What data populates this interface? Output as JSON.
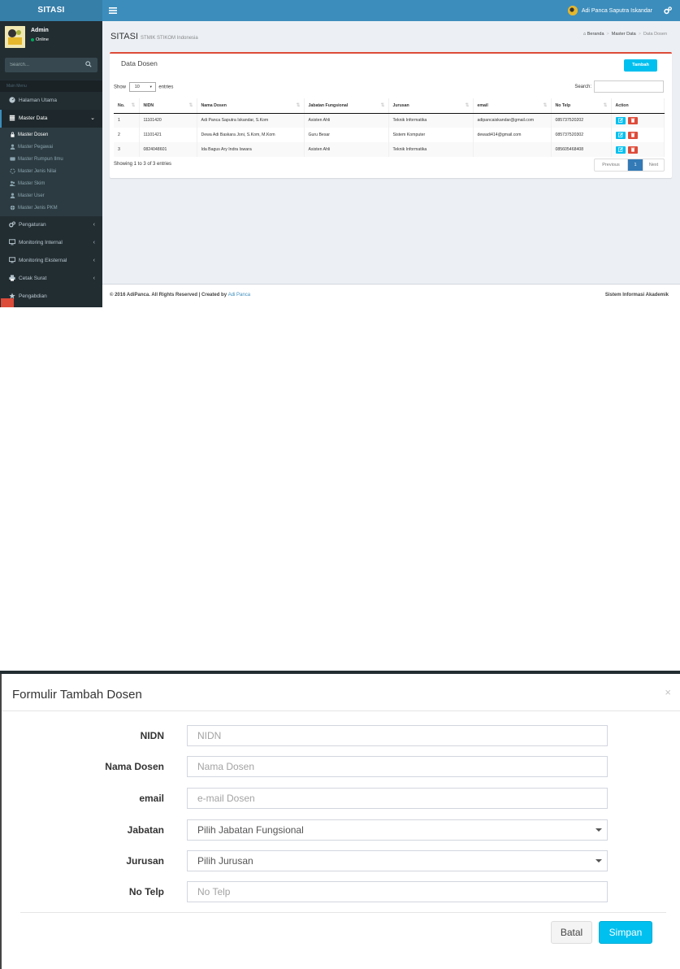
{
  "app": {
    "logo": "SITASI",
    "user": {
      "name": "Admin",
      "status": "Online"
    },
    "search_placeholder": "Search...",
    "menu_header": "Main Menu",
    "nav": {
      "home": "Halaman Utama",
      "master": "Master Data",
      "sub": [
        "Master Dosen",
        "Master Pegawai",
        "Master Rumpun Ilmu",
        "Master Jenis Nilai",
        "Master Skim",
        "Master User",
        "Master Jenis PKM"
      ],
      "pengaturan": "Pengaturan",
      "mon_int": "Monitoring Internal",
      "mon_ext": "Monitoring Eksternal",
      "cetak": "Cetak Surat",
      "pengabdian": "Pengabdian"
    },
    "topbar_user": "Adi Panca Saputra Iskandar",
    "page_title": "SITASI",
    "page_subtitle": "STMIK STIKOM Indonesia",
    "breadcrumb": [
      "Beranda",
      "Master Data",
      "Data Dosen"
    ],
    "box_title": "Data Dosen",
    "add_button": "Tambah",
    "show": {
      "pre": "Show",
      "value": "10",
      "post": "entries"
    },
    "search_label": "Search:",
    "table": {
      "headers": [
        "No.",
        "NIDN",
        "Nama Dosen",
        "Jabatan Fungsional",
        "Jurusan",
        "email",
        "No Telp",
        "Action"
      ],
      "rows": [
        [
          "1",
          "11101420",
          "Adi Panca Saputra Iskandar, S.Kom",
          "Asisten Ahli",
          "Teknik Informatika",
          "adipancaiskandar@gmail.com",
          "085737520202"
        ],
        [
          "2",
          "11101421",
          "Dewa Adi Baskara Joni, S.Kom, M.Kom",
          "Guru Besar",
          "Sistem Komputer",
          "dewadi414@gmail.com",
          "085737520302"
        ],
        [
          "3",
          "0824048601",
          "Ida Bagus Ary Indra Iswara",
          "Asisten Ahli",
          "Teknik Informatika",
          "",
          "085605468408"
        ]
      ]
    },
    "info": "Showing 1 to 3 of 3 entries",
    "pager": {
      "prev": "Previous",
      "page": "1",
      "next": "Next"
    },
    "footer": {
      "left": "© 2016 AdiPanca. All Rights Reserved | Created by",
      "link": "Adi Panca",
      "right": "Sistem Informasi Akademik"
    }
  },
  "modal": {
    "title": "Formulir Tambah Dosen",
    "close": "×",
    "fields": [
      {
        "label": "NIDN",
        "placeholder": "NIDN"
      },
      {
        "label": "Nama Dosen",
        "placeholder": "Nama Dosen"
      },
      {
        "label": "email",
        "placeholder": "e-mail Dosen"
      },
      {
        "label": "Jabatan",
        "value": "Pilih Jabatan Fungsional"
      },
      {
        "label": "Jurusan",
        "value": "Pilih Jurusan"
      },
      {
        "label": "No Telp",
        "placeholder": "No Telp"
      }
    ],
    "cancel": "Batal",
    "save": "Simpan"
  }
}
